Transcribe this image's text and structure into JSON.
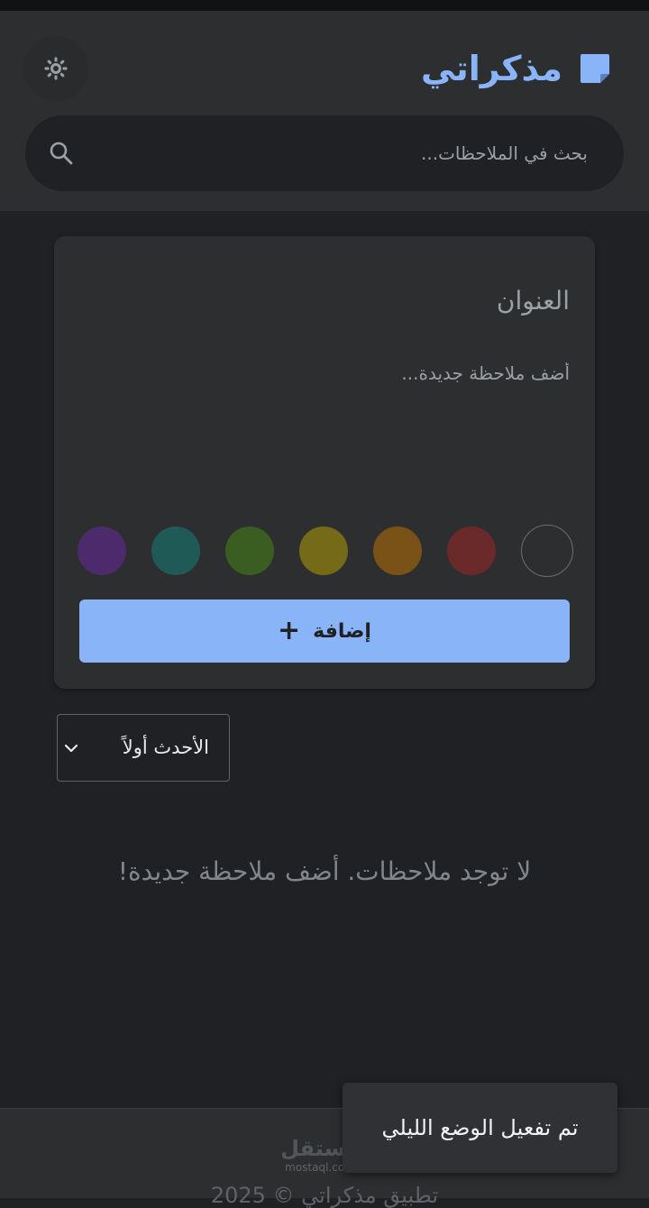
{
  "header": {
    "app_title": "مذكراتي",
    "app_icon": "sticky-note-icon",
    "theme_toggle_icon": "sun-icon",
    "search": {
      "placeholder": "بحث في الملاحظات...",
      "value": "",
      "icon": "search-icon"
    }
  },
  "note_form": {
    "title_placeholder": "العنوان",
    "content_placeholder": "أضف ملاحظة جديدة...",
    "colors": [
      {
        "name": "default",
        "hex": "transparent"
      },
      {
        "name": "red",
        "hex": "#6b2a2a"
      },
      {
        "name": "orange",
        "hex": "#7a5116"
      },
      {
        "name": "yellow",
        "hex": "#756a18"
      },
      {
        "name": "green",
        "hex": "#3a5e21"
      },
      {
        "name": "teal",
        "hex": "#1f5a57"
      },
      {
        "name": "purple",
        "hex": "#4c2a6b"
      }
    ],
    "add_button_label": "إضافة",
    "add_button_icon": "plus-icon"
  },
  "sort": {
    "selected": "الأحدث أولاً"
  },
  "notes": {
    "empty_message": "لا توجد ملاحظات. أضف ملاحظة جديدة!"
  },
  "footer": {
    "copyright": "تطبيق مذكراتي © 2025",
    "watermark_main": "مستقل",
    "watermark_sub": "mostaql.com"
  },
  "toast": {
    "message": "تم تفعيل الوضع الليلي"
  },
  "theme": {
    "accent": "#8ab4f8",
    "background": "#202124",
    "surface": "#2d2e30"
  }
}
